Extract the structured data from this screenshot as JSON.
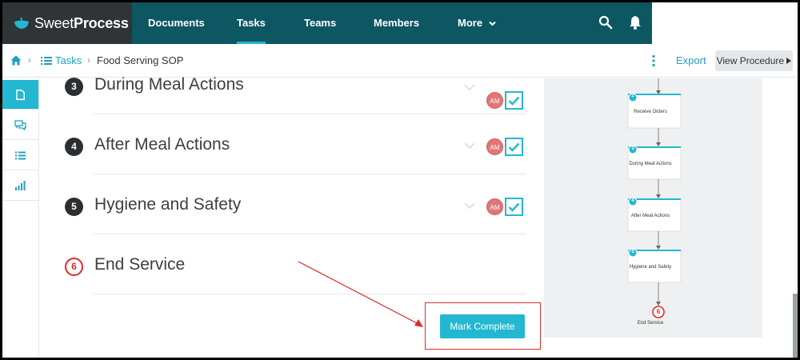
{
  "app": {
    "logo_light": "Sweet",
    "logo_bold": "Process"
  },
  "nav": {
    "items": [
      {
        "label": "Documents"
      },
      {
        "label": "Tasks",
        "active": true
      },
      {
        "label": "Teams"
      },
      {
        "label": "Members"
      },
      {
        "label": "More"
      }
    ]
  },
  "breadcrumb": {
    "tasks_label": "Tasks",
    "current_label": "Food Serving SOP"
  },
  "actions": {
    "export_label": "Export",
    "view_procedure_label": "View Procedure"
  },
  "sidebar": {
    "items": [
      {
        "icon": "document-icon",
        "active": true
      },
      {
        "icon": "comments-icon"
      },
      {
        "icon": "checklist-icon"
      },
      {
        "icon": "stats-icon"
      }
    ]
  },
  "steps": [
    {
      "number": "3",
      "title": "During Meal Actions",
      "assignee": "AM",
      "completed": true
    },
    {
      "number": "4",
      "title": "After Meal Actions",
      "assignee": "AM",
      "completed": true
    },
    {
      "number": "5",
      "title": "Hygiene and Safety",
      "assignee": "AM",
      "completed": true
    },
    {
      "number": "6",
      "title": "End Service",
      "completed": false
    }
  ],
  "mark_complete_label": "Mark Complete",
  "flowchart": {
    "nodes": [
      {
        "number": "2",
        "label": "Receive Orders"
      },
      {
        "number": "3",
        "label": "During Meal Actions"
      },
      {
        "number": "4",
        "label": "After Meal Actions"
      },
      {
        "number": "5",
        "label": "Hygiene and Safety"
      }
    ],
    "end": {
      "number": "6",
      "label": "End Service"
    }
  },
  "colors": {
    "accent": "#23b7d2",
    "nav_bg": "#0d5763",
    "alert_red": "#e02b2b"
  }
}
